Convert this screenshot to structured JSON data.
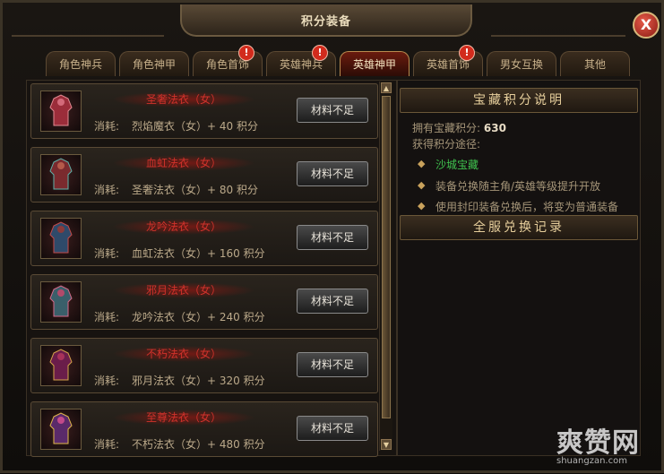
{
  "window": {
    "title": "积分装备",
    "close_label": "X"
  },
  "tabs": [
    {
      "label": "角色神兵",
      "alert": false,
      "active": false
    },
    {
      "label": "角色神甲",
      "alert": false,
      "active": false
    },
    {
      "label": "角色首饰",
      "alert": true,
      "active": false
    },
    {
      "label": "英雄神兵",
      "alert": true,
      "active": false
    },
    {
      "label": "英雄神甲",
      "alert": false,
      "active": true
    },
    {
      "label": "英雄首饰",
      "alert": true,
      "active": false
    },
    {
      "label": "男女互换",
      "alert": false,
      "active": false
    },
    {
      "label": "其他",
      "alert": false,
      "active": false
    }
  ],
  "alert_symbol": "!",
  "items": [
    {
      "name": "圣奢法衣（女）",
      "cost_label": "消耗:",
      "cost": "烈焰魔衣（女）+ 40 积分",
      "button": "材料不足",
      "icon": "armor-icon"
    },
    {
      "name": "血虹法衣（女）",
      "cost_label": "消耗:",
      "cost": "圣奢法衣（女）+ 80 积分",
      "button": "材料不足",
      "icon": "armor-icon"
    },
    {
      "name": "龙吟法衣（女）",
      "cost_label": "消耗:",
      "cost": "血虹法衣（女）+ 160 积分",
      "button": "材料不足",
      "icon": "armor-icon"
    },
    {
      "name": "邪月法衣（女）",
      "cost_label": "消耗:",
      "cost": "龙吟法衣（女）+ 240 积分",
      "button": "材料不足",
      "icon": "armor-icon"
    },
    {
      "name": "不朽法衣（女）",
      "cost_label": "消耗:",
      "cost": "邪月法衣（女）+ 320 积分",
      "button": "材料不足",
      "icon": "armor-icon"
    },
    {
      "name": "至尊法衣（女）",
      "cost_label": "消耗:",
      "cost": "不朽法衣（女）+ 480 积分",
      "button": "材料不足",
      "icon": "armor-icon"
    }
  ],
  "info": {
    "header": "宝藏积分说明",
    "points_label": "拥有宝藏积分:",
    "points_value": "630",
    "ways_label": "获得积分途径:",
    "bullets": [
      {
        "text": "沙城宝藏",
        "highlight": true
      },
      {
        "text": "装备兑换随主角/英雄等级提升开放",
        "highlight": false
      },
      {
        "text": "使用封印装备兑换后，将变为普通装备",
        "highlight": false
      }
    ],
    "record_header": "全服兑换记录"
  },
  "watermark": {
    "big": "爽赞网",
    "small": "shuangzan.com"
  },
  "colors": {
    "item_name": "#d0322b",
    "highlight": "#3fc24e",
    "accent": "#b88a4e"
  }
}
